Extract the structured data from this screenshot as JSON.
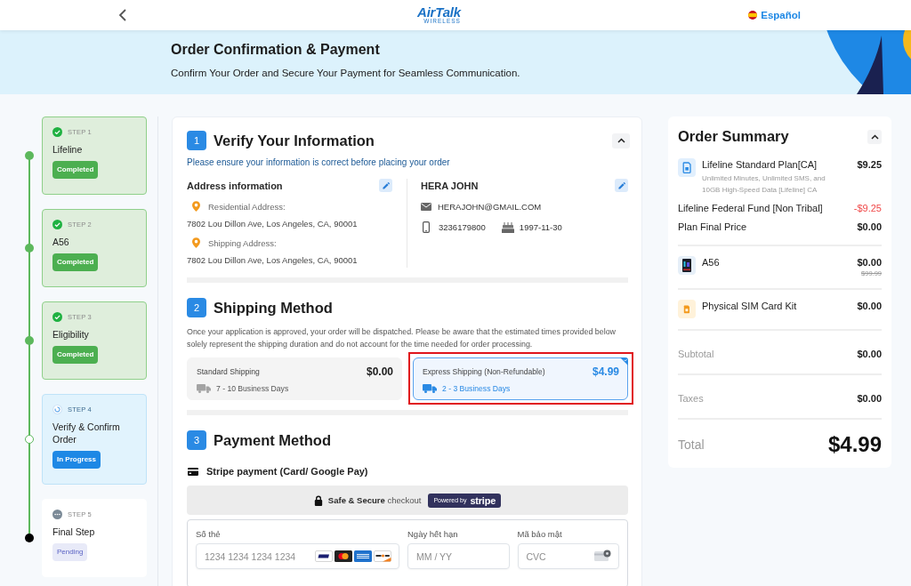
{
  "header": {
    "logo": {
      "name": "AirTalk",
      "tagline": "WIRELESS"
    },
    "language": "Español"
  },
  "banner": {
    "title": "Order Confirmation & Payment",
    "subtitle": "Confirm Your Order and Secure Your Payment for Seamless Communication."
  },
  "steps": [
    {
      "step": "STEP 1",
      "title": "Lifeline",
      "badge": "Completed",
      "kind": "completed"
    },
    {
      "step": "STEP 2",
      "title": "A56",
      "badge": "Completed",
      "kind": "completed"
    },
    {
      "step": "STEP 3",
      "title": "Eligibility",
      "badge": "Completed",
      "kind": "completed"
    },
    {
      "step": "STEP 4",
      "title": "Verify & Confirm Order",
      "badge": "In Progress",
      "kind": "in_progress"
    },
    {
      "step": "STEP 5",
      "title": "Final Step",
      "badge": "Pending",
      "kind": "pending"
    }
  ],
  "verify": {
    "number": "1",
    "title": "Verify Your Information",
    "note": "Please ensure your information is correct before placing your order",
    "address": {
      "heading": "Address information",
      "entries": [
        {
          "label": "Residential Address:",
          "value": "7802 Lou Dillon Ave, Los Angeles, CA, 90001"
        },
        {
          "label": "Shipping Address:",
          "value": "7802 Lou Dillon Ave, Los Angeles, CA, 90001"
        }
      ]
    },
    "contact": {
      "name": "HERA JOHN",
      "email": "HERAJOHN@GMAIL.COM",
      "phone": "3236179800",
      "birthday": "1997-11-30"
    }
  },
  "shipping": {
    "number": "2",
    "title": "Shipping Method",
    "note": "Once your application is approved, your order will be dispatched. Please be aware that the estimated times provided below solely represent the shipping duration and do not account for the time needed for order processing.",
    "options": [
      {
        "name": "Standard Shipping",
        "price": "$0.00",
        "time": "7 - 10 Business Days",
        "selected": false,
        "highlighted": false
      },
      {
        "name": "Express Shipping (Non-Refundable)",
        "price": "$4.99",
        "time": "2 - 3 Business Days",
        "selected": true,
        "highlighted": true
      }
    ]
  },
  "payment": {
    "number": "3",
    "title": "Payment Method",
    "method": "Stripe payment (Card/ Google Pay)",
    "secure_note": "**Safe & Secure** checkout",
    "badge": {
      "prefix": "Powered by",
      "brand": "stripe"
    },
    "fields": [
      {
        "kind": "card_number",
        "label": "Số thẻ",
        "placeholder": "1234 1234 1234 1234"
      },
      {
        "kind": "expiry",
        "label": "Ngày hết hạn",
        "placeholder": "MM / YY"
      },
      {
        "kind": "cvc",
        "label": "Mã bảo mật",
        "placeholder": "CVC"
      }
    ]
  },
  "order_summary": {
    "title": "Order Summary",
    "plan": {
      "name": "Lifeline Standard Plan[CA]",
      "price": "$9.25",
      "description": "Unlimited Minutes, Unlimited SMS, and 10GB High-Speed Data [Lifeline] CA"
    },
    "adjustments": [
      {
        "kind": "discount",
        "label": "Lifeline Federal Fund [Non Tribal]",
        "amount": "-$9.25"
      },
      {
        "kind": "final",
        "label": "Plan Final Price",
        "amount": "$0.00"
      }
    ],
    "products": [
      {
        "kind": "phone",
        "name": "A56",
        "price": "$0.00",
        "original_price": "$99.99"
      },
      {
        "kind": "sim",
        "name": "Physical SIM Card Kit",
        "price": "$0.00"
      }
    ],
    "charges": [
      {
        "label": "Subtotal",
        "amount": "$0.00"
      },
      {
        "label": "Taxes",
        "amount": "$0.00"
      }
    ],
    "total": {
      "label": "Total",
      "amount": "$4.99"
    }
  }
}
